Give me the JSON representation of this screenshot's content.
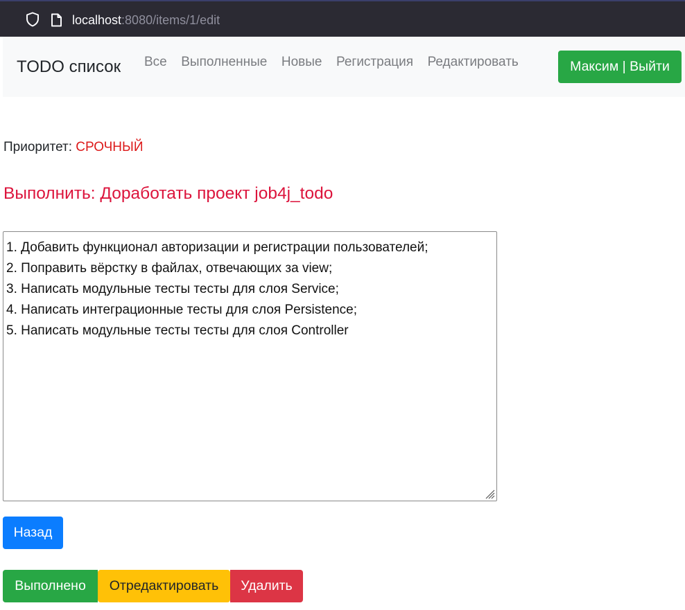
{
  "browser": {
    "url_host": "localhost",
    "url_rest": ":8080/items/1/edit"
  },
  "navbar": {
    "brand": "TODO список",
    "links": [
      "Все",
      "Выполненные",
      "Новые",
      "Регистрация",
      "Редактировать"
    ],
    "user_button": "Максим | Выйти"
  },
  "item": {
    "priority_label": "Приоритет:",
    "priority_value": "СРОЧНЫЙ",
    "title": "Выполнить: Доработать проект job4j_todo",
    "description_lines": [
      "1. Добавить функционал авторизации и регистрации пользователей;",
      "2. Поправить вёрстку в файлах, отвечающих за view;",
      "3. Написать модульные тесты тесты для слоя Service;",
      "4. Написать интеграционные тесты для слоя Persistence;",
      "5. Написать модульные тесты тесты для слоя Controller"
    ]
  },
  "buttons": {
    "back": "Назад",
    "done": "Выполнено",
    "edit": "Отредактировать",
    "delete": "Удалить"
  },
  "colors": {
    "navbar_bg": "#f8f9fa",
    "success": "#28a745",
    "primary": "#0b7dff",
    "warning": "#ffc107",
    "danger": "#dc3545",
    "title": "#dc143c",
    "priority": "#dc1a1a"
  },
  "icons": [
    "shield-icon",
    "page-icon",
    "resize-grip-icon"
  ]
}
